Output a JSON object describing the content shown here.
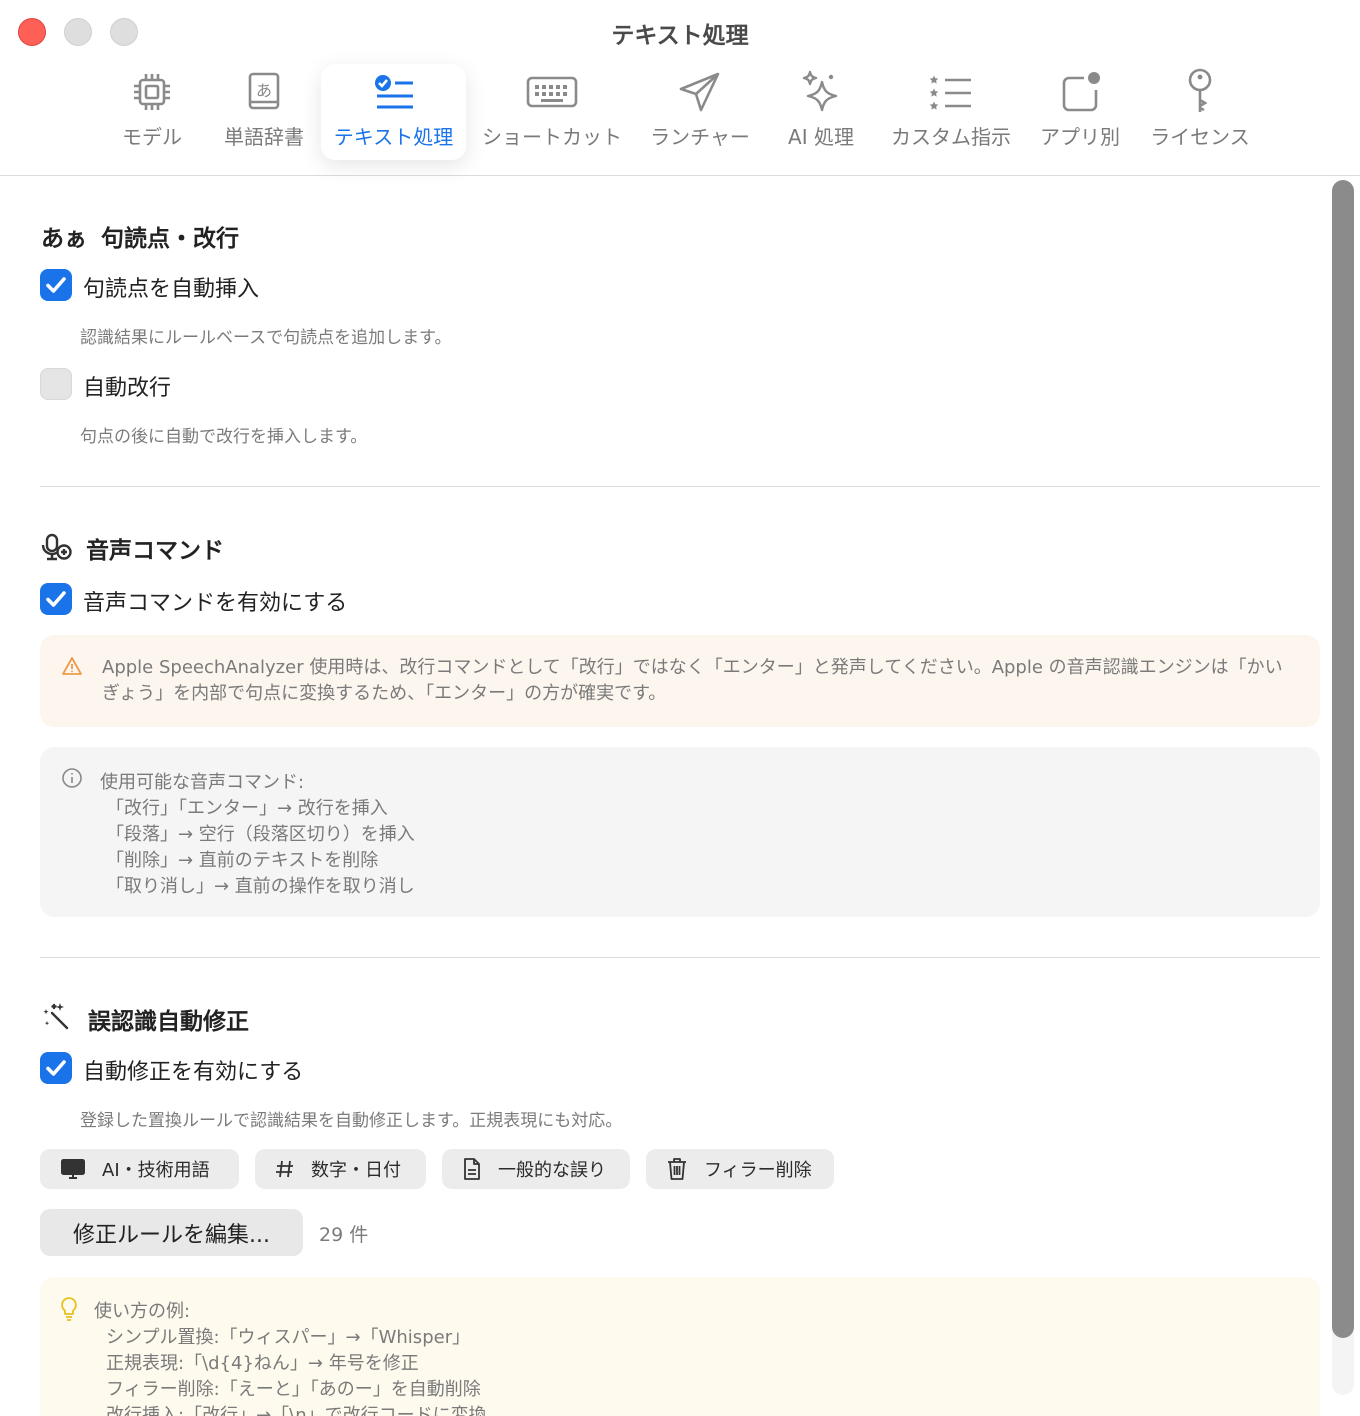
{
  "window": {
    "title": "テキスト処理"
  },
  "toolbar": {
    "tabs": [
      {
        "label": "モデル",
        "icon": "cpu-icon"
      },
      {
        "label": "単語辞書",
        "icon": "dictionary-icon"
      },
      {
        "label": "テキスト処理",
        "icon": "checklist-icon",
        "active": true
      },
      {
        "label": "ショートカット",
        "icon": "keyboard-icon"
      },
      {
        "label": "ランチャー",
        "icon": "paper-plane-icon"
      },
      {
        "label": "AI 処理",
        "icon": "sparkles-icon"
      },
      {
        "label": "カスタム指示",
        "icon": "star-list-icon"
      },
      {
        "label": "アプリ別",
        "icon": "app-badge-icon"
      },
      {
        "label": "ライセンス",
        "icon": "key-icon"
      }
    ]
  },
  "colors": {
    "accent": "#1a73e8",
    "close": "#fe5f57",
    "warning": "#f0a050",
    "tip": "#e8c020"
  },
  "punctuation": {
    "section_icon": "あぁ",
    "title": "句読点・改行",
    "auto_punct_label": "句読点を自動挿入",
    "auto_punct_checked": true,
    "auto_punct_desc": "認識結果にルールベースで句読点を追加します。",
    "auto_newline_label": "自動改行",
    "auto_newline_checked": false,
    "auto_newline_desc": "句点の後に自動で改行を挿入します。"
  },
  "voice": {
    "title": "音声コマンド",
    "enable_label": "音声コマンドを有効にする",
    "enable_checked": true,
    "warning": "Apple SpeechAnalyzer 使用時は、改行コマンドとして「改行」ではなく「エンター」と発声してください。Apple の音声認識エンジンは「かいぎょう」を内部で句点に変換するため、「エンター」の方が確実です。",
    "info_title": "使用可能な音声コマンド:",
    "info_lines": [
      "「改行」「エンター」→ 改行を挿入",
      "「段落」→ 空行（段落区切り）を挿入",
      "「削除」→ 直前のテキストを削除",
      "「取り消し」→ 直前の操作を取り消し"
    ]
  },
  "autocorrect": {
    "title": "誤認識自動修正",
    "enable_label": "自動修正を有効にする",
    "enable_checked": true,
    "desc": "登録した置換ルールで認識結果を自動修正します。正規表現にも対応。",
    "chips": [
      {
        "label": "AI・技術用語",
        "icon": "monitor-icon"
      },
      {
        "label": "数字・日付",
        "icon": "hash-icon"
      },
      {
        "label": "一般的な誤り",
        "icon": "document-icon"
      },
      {
        "label": "フィラー削除",
        "icon": "trash-icon"
      }
    ],
    "edit_button": "修正ルールを編集...",
    "rule_count": "29 件",
    "tip_title": "使い方の例:",
    "tip_lines": [
      "シンプル置換:「ウィスパー」→「Whisper」",
      "正規表現:「\\d{4}ねん」→ 年号を修正",
      "フィラー削除:「えーと」「あのー」を自動削除",
      "改行挿入:「改行」→「\\n」で改行コードに変換"
    ]
  }
}
